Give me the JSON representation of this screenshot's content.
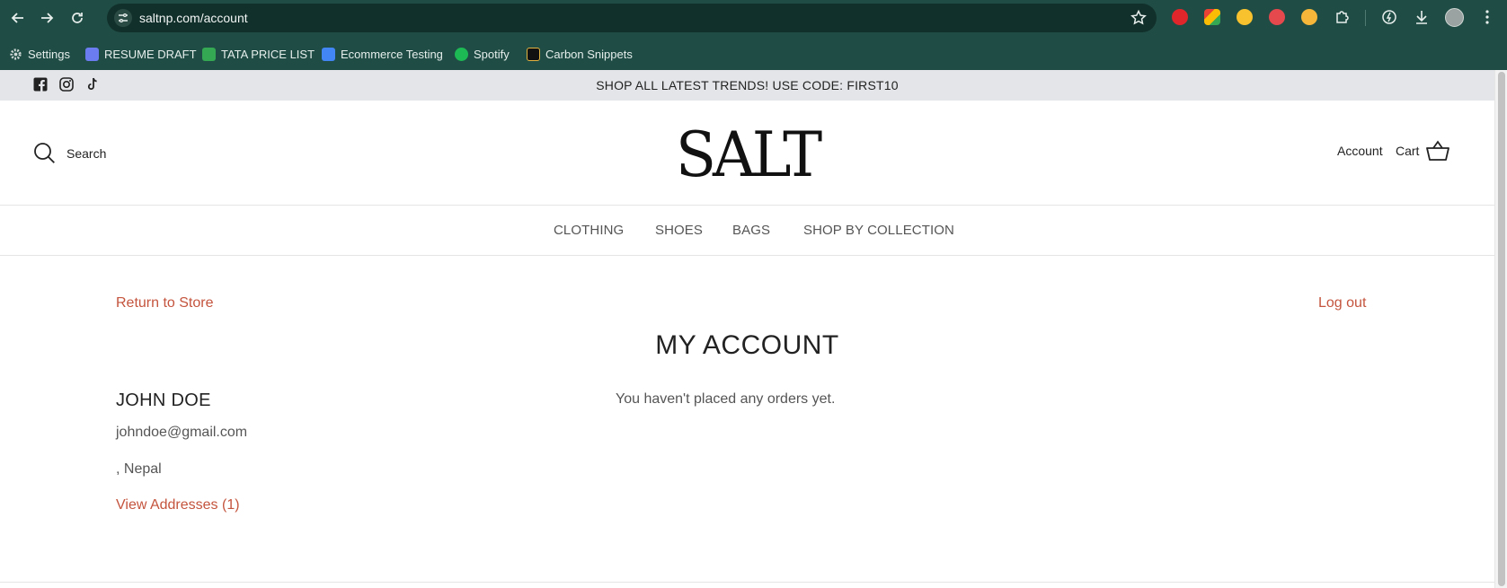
{
  "browser": {
    "url": "saltnp.com/account",
    "bookmarks": [
      {
        "label": "Settings",
        "icon": "gear-icon",
        "color": "#cfd8d6"
      },
      {
        "label": "RESUME DRAFT",
        "icon": "document-icon",
        "color": "#6b7cf0"
      },
      {
        "label": "TATA PRICE LIST",
        "icon": "sheets-icon",
        "color": "#34a853"
      },
      {
        "label": "Ecommerce Testing",
        "icon": "docs-icon",
        "color": "#4285f4"
      },
      {
        "label": "Spotify",
        "icon": "spotify-icon",
        "color": "#1db954"
      },
      {
        "label": "Carbon Snippets",
        "icon": "carbon-icon",
        "color": "#111111"
      }
    ],
    "extensions": [
      {
        "icon": "red-hand-extension-icon",
        "color": "#e0262b"
      },
      {
        "icon": "colorful-extension-icon",
        "color": "#f3a81c"
      },
      {
        "icon": "yellow-clock-extension-icon",
        "color": "#f7c22e"
      },
      {
        "icon": "red-badge-extension-icon",
        "color": "#e5484d"
      },
      {
        "icon": "yellow-face-extension-icon",
        "color": "#f5b63a"
      }
    ]
  },
  "announcement": {
    "text": "SHOP ALL LATEST TRENDS! USE CODE: FIRST10",
    "social": [
      "facebook-icon",
      "instagram-icon",
      "tiktok-icon"
    ]
  },
  "header": {
    "search_label": "Search",
    "logo": "SALT",
    "account_label": "Account",
    "cart_label": "Cart"
  },
  "menu": {
    "items": [
      "CLOTHING",
      "SHOES",
      "BAGS",
      "SHOP BY COLLECTION"
    ]
  },
  "account": {
    "return_link": "Return to Store",
    "logout_link": "Log out",
    "title": "MY ACCOUNT",
    "customer_name": "JOHN DOE",
    "email": "johndoe@gmail.com",
    "country": ", Nepal",
    "view_addresses": "View Addresses (1)",
    "orders_empty": "You haven't placed any orders yet."
  },
  "colors": {
    "chrome": "#1f4d45",
    "announcement_bg": "#e3e5e8",
    "accent_link": "#c4543d"
  }
}
